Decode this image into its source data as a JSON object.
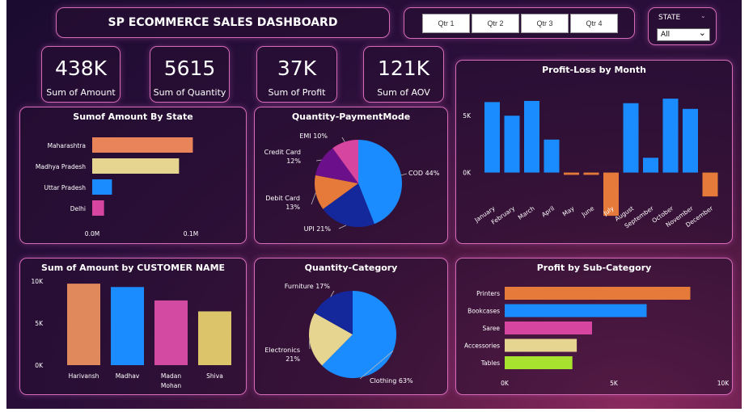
{
  "header": {
    "title": "SP  ECOMMERCE SALES DASHBOARD"
  },
  "slicers": {
    "quarters": [
      "Qtr 1",
      "Qtr 2",
      "Qtr 3",
      "Qtr 4"
    ],
    "state_label": "STATE",
    "state_value": "All"
  },
  "kpis": [
    {
      "value": "438K",
      "label": "Sum of Amount"
    },
    {
      "value": "5615",
      "label": "Sum of Quantity"
    },
    {
      "value": "37K",
      "label": "Sum of Profit"
    },
    {
      "value": "121K",
      "label": "Sum of AOV"
    }
  ],
  "colors": {
    "blue": "#1a8cff",
    "orange": "#e8835a",
    "sand": "#e5d590",
    "pink": "#d6459f",
    "purple": "#6b0f8a",
    "navy": "#14279b",
    "darkorange": "#e67a3a",
    "lime": "#a7e22e",
    "tan": "#e0895c",
    "mustard": "#dcc46a",
    "pink2": "#d24aa2"
  },
  "chart_data": [
    {
      "id": "state",
      "type": "bar",
      "orientation": "horizontal",
      "title": "Sumof Amount By State",
      "categories": [
        "Maharashtra",
        "Madhya Pradesh",
        "Uttar Pradesh",
        "Delhi"
      ],
      "values": [
        0.102,
        0.088,
        0.02,
        0.012
      ],
      "xticks": [
        "0.0M",
        "0.1M"
      ],
      "xlim": [
        0,
        0.1
      ],
      "colors": [
        "#e8835a",
        "#e5d590",
        "#1a8cff",
        "#d6459f"
      ]
    },
    {
      "id": "payment",
      "type": "pie",
      "title": "Quantity-PaymentMode",
      "labels": [
        "COD",
        "UPI",
        "Debit Card",
        "Credit Card",
        "EMI"
      ],
      "values": [
        44,
        21,
        13,
        12,
        10
      ],
      "label_text": [
        "COD 44%",
        "UPI 21%",
        "Debit Card\n13%",
        "Credit Card\n12%",
        "EMI 10%"
      ],
      "colors": [
        "#1a8cff",
        "#14279b",
        "#e67a3a",
        "#6b0f8a",
        "#d6459f"
      ]
    },
    {
      "id": "profit_month",
      "type": "bar",
      "title": "Profit-Loss by Month",
      "categories": [
        "January",
        "February",
        "March",
        "April",
        "May",
        "June",
        "July",
        "August",
        "September",
        "October",
        "November",
        "December"
      ],
      "values": [
        6200,
        5000,
        6300,
        2900,
        -200,
        -200,
        -3800,
        6100,
        1300,
        6500,
        5600,
        -2100
      ],
      "yticks": [
        "0K",
        "5K"
      ],
      "ylim": [
        -5000,
        8000
      ],
      "colors_positive": "#1a8cff",
      "colors_negative": "#e67a3a"
    },
    {
      "id": "customer",
      "type": "bar",
      "title": "Sum of Amount by CUSTOMER NAME",
      "categories": [
        "Harivansh",
        "Madhav",
        "Madan Mohan",
        "Shiva"
      ],
      "values": [
        9700,
        9300,
        7700,
        6400
      ],
      "yticks": [
        "0K",
        "5K",
        "10K"
      ],
      "ylim": [
        0,
        10000
      ],
      "colors": [
        "#e0895c",
        "#1a8cff",
        "#d24aa2",
        "#dcc46a"
      ]
    },
    {
      "id": "category",
      "type": "pie",
      "title": "Quantity-Category",
      "labels": [
        "Clothing",
        "Electronics",
        "Furniture"
      ],
      "values": [
        63,
        21,
        17
      ],
      "label_text": [
        "Clothing 63%",
        "Electronics\n21%",
        "Furniture 17%"
      ],
      "colors": [
        "#1a8cff",
        "#e5d590",
        "#14279b"
      ]
    },
    {
      "id": "subcat",
      "type": "bar",
      "orientation": "horizontal",
      "title": "Profit by Sub-Category",
      "categories": [
        "Printers",
        "Bookcases",
        "Saree",
        "Accessories",
        "Tables"
      ],
      "values": [
        8500,
        6500,
        4000,
        3300,
        3100
      ],
      "xticks": [
        "0K",
        "5K",
        "10K"
      ],
      "xlim": [
        0,
        10000
      ],
      "colors": [
        "#e67a3a",
        "#1a8cff",
        "#d6459f",
        "#e5d590",
        "#a7e22e"
      ]
    }
  ]
}
